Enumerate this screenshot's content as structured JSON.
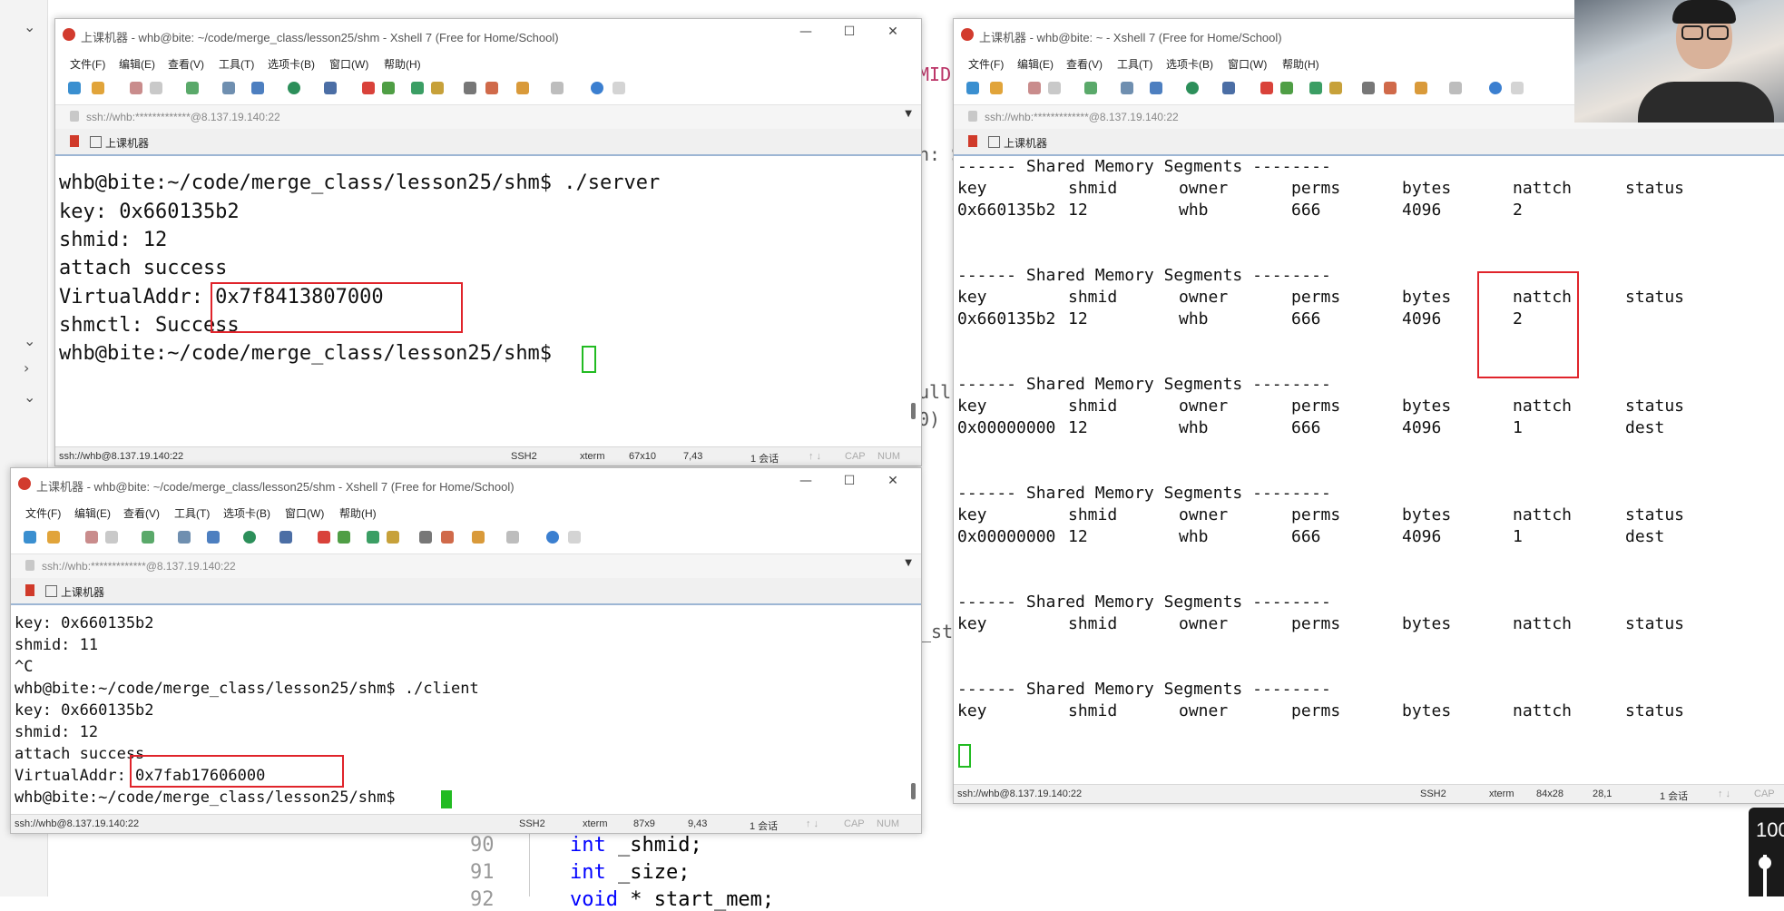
{
  "colors": {
    "highlight": "#e0242b",
    "cursor_green": "#22bb22",
    "title_icon": "#d23b2e",
    "tab_underline": "#9db6d4"
  },
  "background": {
    "code_lines": [
      {
        "num": "90",
        "kw": "int",
        "rest": " _shmid;"
      },
      {
        "num": "91",
        "kw": "int",
        "rest": " _size;"
      },
      {
        "num": "92",
        "kw": "void",
        "rest": " * start_mem;"
      }
    ],
    "fragments": {
      "mid": "MID",
      "n_s": "n: S",
      "nullp": "ullp",
      "paren": "0)",
      "st": "_st"
    },
    "volume_text": "100"
  },
  "menu": [
    "文件(F)",
    "编辑(E)",
    "查看(V)",
    "工具(T)",
    "选项卡(B)",
    "窗口(W)",
    "帮助(H)"
  ],
  "win_server": {
    "title": "上课机器 - whb@bite: ~/code/merge_class/lesson25/shm - Xshell 7 (Free for Home/School)",
    "address": "ssh://whb:*************@8.137.19.140:22",
    "tab_label": "上课机器",
    "lines": [
      "whb@bite:~/code/merge_class/lesson25/shm$ ./server",
      "key: 0x660135b2",
      "shmid: 12",
      "attach success",
      "VirtualAddr: 0x7f8413807000",
      "shmctl: Success",
      "whb@bite:~/code/merge_class/lesson25/shm$ "
    ],
    "status": {
      "conn": "ssh://whb@8.137.19.140:22",
      "proto": "SSH2",
      "term": "xterm",
      "size": "67x10",
      "pos": "7,43",
      "sessions": "1 会话",
      "cap": "CAP",
      "num": "NUM"
    }
  },
  "win_client": {
    "title": "上课机器 - whb@bite: ~/code/merge_class/lesson25/shm - Xshell 7 (Free for Home/School)",
    "address": "ssh://whb:*************@8.137.19.140:22",
    "tab_label": "上课机器",
    "lines": [
      "key: 0x660135b2",
      "shmid: 11",
      "^C",
      "whb@bite:~/code/merge_class/lesson25/shm$ ./client",
      "key: 0x660135b2",
      "shmid: 12",
      "attach success",
      "VirtualAddr: 0x7fab17606000",
      "whb@bite:~/code/merge_class/lesson25/shm$ "
    ],
    "status": {
      "conn": "ssh://whb@8.137.19.140:22",
      "proto": "SSH2",
      "term": "xterm",
      "size": "87x9",
      "pos": "9,43",
      "sessions": "1 会话",
      "cap": "CAP",
      "num": "NUM"
    }
  },
  "win_ipcs": {
    "title": "上课机器 - whb@bite: ~ - Xshell 7 (Free for Home/School)",
    "address": "ssh://whb:*************@8.137.19.140:22",
    "tab_label": "上课机器",
    "segment_header": "------ Shared Memory Segments --------",
    "columns": [
      "key",
      "shmid",
      "owner",
      "perms",
      "bytes",
      "nattch",
      "status"
    ],
    "blocks": [
      [
        "0x660135b2",
        "12",
        "whb",
        "666",
        "4096",
        "2",
        ""
      ],
      [
        "0x660135b2",
        "12",
        "whb",
        "666",
        "4096",
        "2",
        ""
      ],
      [
        "0x00000000",
        "12",
        "whb",
        "666",
        "4096",
        "1",
        "dest"
      ],
      [
        "0x00000000",
        "12",
        "whb",
        "666",
        "4096",
        "1",
        "dest"
      ],
      null,
      null
    ],
    "status": {
      "conn": "ssh://whb@8.137.19.140:22",
      "proto": "SSH2",
      "term": "xterm",
      "size": "84x28",
      "pos": "28,1",
      "sessions": "1 会话",
      "cap": "CAP"
    }
  }
}
